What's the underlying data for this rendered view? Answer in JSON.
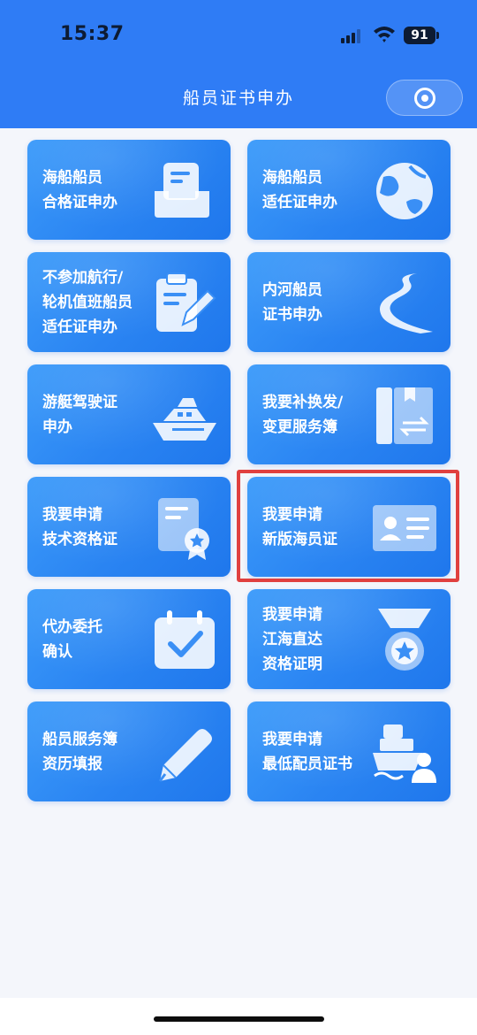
{
  "status_bar": {
    "time": "15:37",
    "battery": "91"
  },
  "nav": {
    "title": "船员证书申办"
  },
  "colors": {
    "nav_background": "#2f7cf5",
    "tile_background": "#2a84f2",
    "highlight_border": "#e0403f",
    "page_background": "#f4f6fb"
  },
  "tiles": [
    {
      "lines": [
        "海船船员",
        "合格证申办"
      ],
      "icon": "certificate-tray-icon"
    },
    {
      "lines": [
        "海船船员",
        "适任证申办"
      ],
      "icon": "globe-icon"
    },
    {
      "lines": [
        "不参加航行/",
        "轮机值班船员",
        "适任证申办"
      ],
      "icon": "clipboard-edit-icon"
    },
    {
      "lines": [
        "内河船员",
        "证书申办"
      ],
      "icon": "river-icon"
    },
    {
      "lines": [
        "游艇驾驶证",
        "申办"
      ],
      "icon": "yacht-icon"
    },
    {
      "lines": [
        "我要补换发/",
        "变更服务簿"
      ],
      "icon": "book-exchange-icon"
    },
    {
      "lines": [
        "我要申请",
        "技术资格证"
      ],
      "icon": "award-document-icon"
    },
    {
      "lines": [
        "我要申请",
        "新版海员证"
      ],
      "icon": "id-card-icon"
    },
    {
      "lines": [
        "代办委托",
        "确认"
      ],
      "icon": "calendar-check-icon"
    },
    {
      "lines": [
        "我要申请",
        "江海直达",
        "资格证明"
      ],
      "icon": "medal-icon"
    },
    {
      "lines": [
        "船员服务簿",
        "资历填报"
      ],
      "icon": "pencil-icon"
    },
    {
      "lines": [
        "我要申请",
        "最低配员证书"
      ],
      "icon": "ship-crew-icon"
    }
  ],
  "highlighted_tile_index": 7
}
